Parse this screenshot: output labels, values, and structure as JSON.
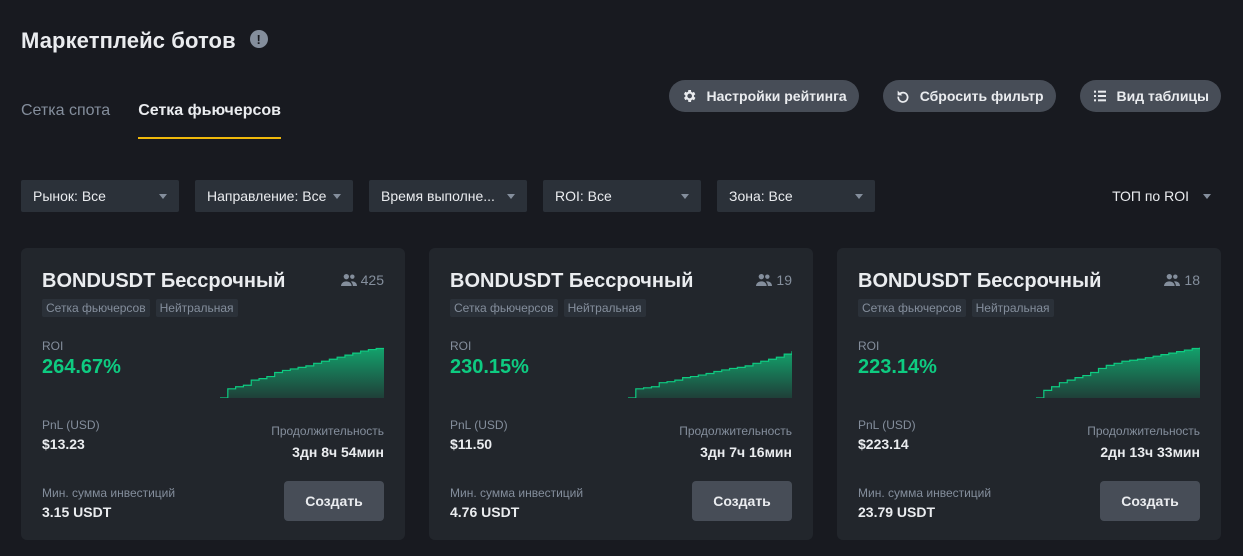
{
  "header": {
    "title": "Маркетплейс ботов",
    "info_icon": "!"
  },
  "tabs": [
    {
      "label": "Сетка спота",
      "active": false
    },
    {
      "label": "Сетка фьючерсов",
      "active": true
    }
  ],
  "actions": {
    "rating_settings": "Настройки рейтинга",
    "reset_filter": "Сбросить фильтр",
    "table_view": "Вид таблицы"
  },
  "filters": {
    "market": "Рынок: Все",
    "direction": "Направление: Все",
    "runtime": "Время выполне...",
    "roi": "ROI: Все",
    "zone": "Зона: Все"
  },
  "sort": {
    "label": "ТОП по ROI"
  },
  "colors": {
    "accent": "#f0b90b",
    "positive": "#0ecb81",
    "background": "#181a20",
    "card": "#22262c"
  },
  "cards": [
    {
      "title": "BONDUSDT Бессрочный",
      "followers": "425",
      "tags": [
        "Сетка фьючерсов",
        "Нейтральная"
      ],
      "roi_label": "ROI",
      "roi": "264.67%",
      "pnl_label": "PnL (USD)",
      "pnl": "$13.23",
      "duration_label": "Продолжительность",
      "duration": "3дн 8ч 54мин",
      "min_invest_label": "Мин. сумма инвестиций",
      "min_invest": "3.15 USDT",
      "create_label": "Создать",
      "trend": [
        0,
        0.18,
        0.22,
        0.25,
        0.35,
        0.38,
        0.42,
        0.5,
        0.54,
        0.57,
        0.6,
        0.63,
        0.68,
        0.72,
        0.76,
        0.8,
        0.84,
        0.88,
        0.92,
        0.95,
        0.97,
        0.98
      ]
    },
    {
      "title": "BONDUSDT Бессрочный",
      "followers": "19",
      "tags": [
        "Сетка фьючерсов",
        "Нейтральная"
      ],
      "roi_label": "ROI",
      "roi": "230.15%",
      "pnl_label": "PnL (USD)",
      "pnl": "$11.50",
      "duration_label": "Продолжительность",
      "duration": "3дн 7ч 16мин",
      "min_invest_label": "Мин. сумма инвестиций",
      "min_invest": "4.76 USDT",
      "create_label": "Создать",
      "trend": [
        0,
        0.18,
        0.2,
        0.22,
        0.3,
        0.32,
        0.35,
        0.4,
        0.42,
        0.45,
        0.48,
        0.52,
        0.55,
        0.58,
        0.6,
        0.63,
        0.68,
        0.72,
        0.76,
        0.8,
        0.86,
        0.92
      ]
    },
    {
      "title": "BONDUSDT Бессрочный",
      "followers": "18",
      "tags": [
        "Сетка фьючерсов",
        "Нейтральная"
      ],
      "roi_label": "ROI",
      "roi": "223.14%",
      "pnl_label": "PnL (USD)",
      "pnl": "$223.14",
      "duration_label": "Продолжительность",
      "duration": "2дн 13ч 33мин",
      "min_invest_label": "Мин. сумма инвестиций",
      "min_invest": "23.79 USDT",
      "create_label": "Создать",
      "trend": [
        0,
        0.15,
        0.22,
        0.3,
        0.35,
        0.4,
        0.44,
        0.5,
        0.58,
        0.64,
        0.68,
        0.72,
        0.74,
        0.76,
        0.79,
        0.82,
        0.85,
        0.88,
        0.91,
        0.94,
        0.97,
        0.99
      ]
    }
  ]
}
